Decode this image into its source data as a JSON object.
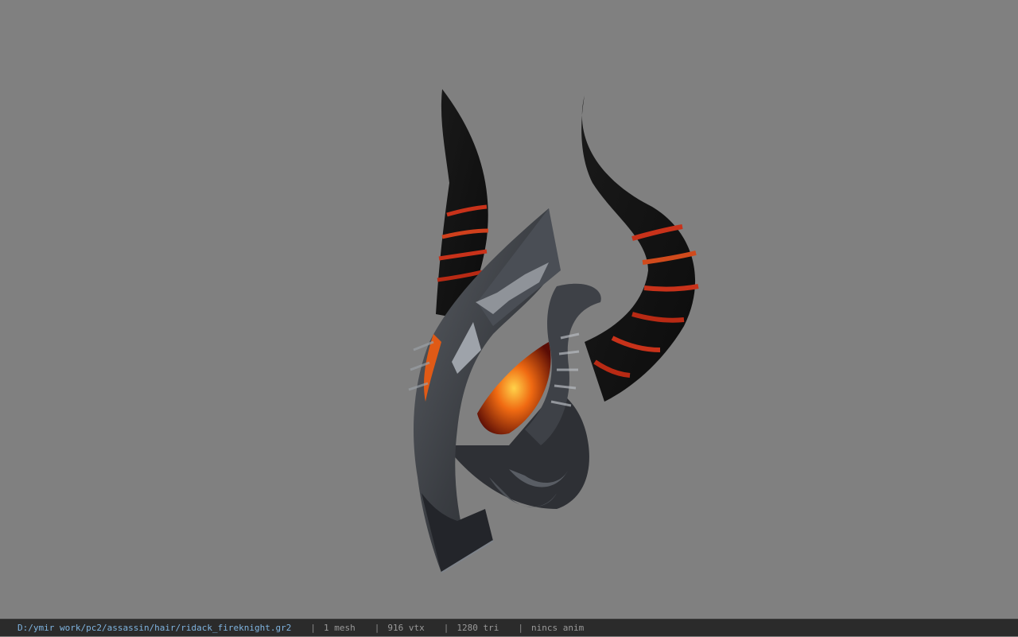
{
  "viewer": {
    "background_color": "#808080",
    "model_name": "ridack_fireknight"
  },
  "status": {
    "file_path": "D:/ymir work/pc2/assassin/hair/ridack_fireknight.gr2",
    "separator": "|",
    "mesh_count": "1 mesh",
    "vertex_count": "916 vtx",
    "triangle_count": "1280 tri",
    "animation": "nincs anim"
  }
}
